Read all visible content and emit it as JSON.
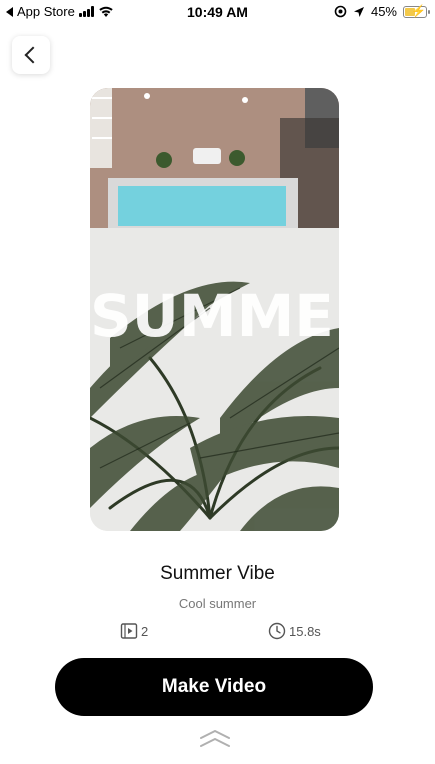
{
  "status_bar": {
    "back_app": "App Store",
    "time": "10:49 AM",
    "battery": "45%"
  },
  "template": {
    "overlay_text": "SUMMER",
    "title": "Summer Vibe",
    "subtitle": "Cool summer",
    "clips": "2",
    "duration": "15.8s"
  },
  "actions": {
    "make_video": "Make Video"
  },
  "icons": {
    "back": "chevron-left-icon",
    "clips": "film-clip-icon",
    "duration": "clock-icon",
    "swipe_up": "double-chevron-up-icon"
  }
}
